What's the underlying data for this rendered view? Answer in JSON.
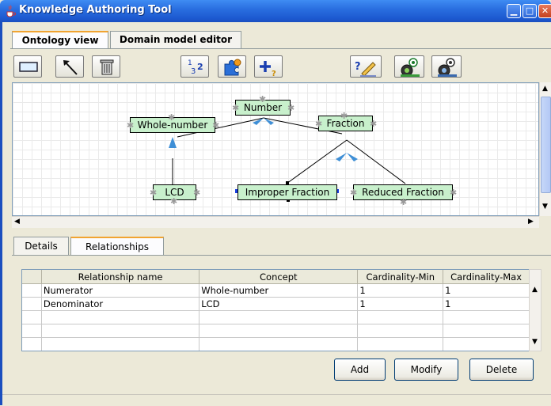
{
  "window": {
    "title": "Knowledge Authoring Tool"
  },
  "main_tabs": [
    {
      "label": "Ontology view",
      "selected": true
    },
    {
      "label": "Domain model editor",
      "selected": false
    }
  ],
  "toolbar": {
    "tools": [
      "rectangle-tool-icon",
      "arrow-tool-icon",
      "trash-icon",
      "numbering-icon",
      "puzzle-icon",
      "add-relation-icon",
      "help-edit-icon",
      "gear-settings-icon",
      "gear-settings-alt-icon"
    ],
    "numbering_label": "1 3 2"
  },
  "diagram": {
    "nodes": [
      "Number",
      "Whole-number",
      "Fraction",
      "LCD",
      "Improper Fraction",
      "Reduced Fraction"
    ]
  },
  "detail_tabs": [
    {
      "label": "Details",
      "selected": false
    },
    {
      "label": "Relationships",
      "selected": true
    }
  ],
  "relationships_table": {
    "columns": [
      "Relationship name",
      "Concept",
      "Cardinality-Min",
      "Cardinality-Max"
    ],
    "rows": [
      [
        "Numerator",
        "Whole-number",
        "1",
        "1"
      ],
      [
        "Denominator",
        "LCD",
        "1",
        "1"
      ],
      [
        "",
        "",
        "",
        ""
      ],
      [
        "",
        "",
        "",
        ""
      ],
      [
        "",
        "",
        "",
        ""
      ]
    ]
  },
  "buttons": {
    "add": "Add",
    "modify": "Modify",
    "delete": "Delete"
  },
  "colors": {
    "titlebar": "#2a6fe0",
    "node_fill": "#c8f0cc",
    "tab_highlight": "#f1a431"
  }
}
